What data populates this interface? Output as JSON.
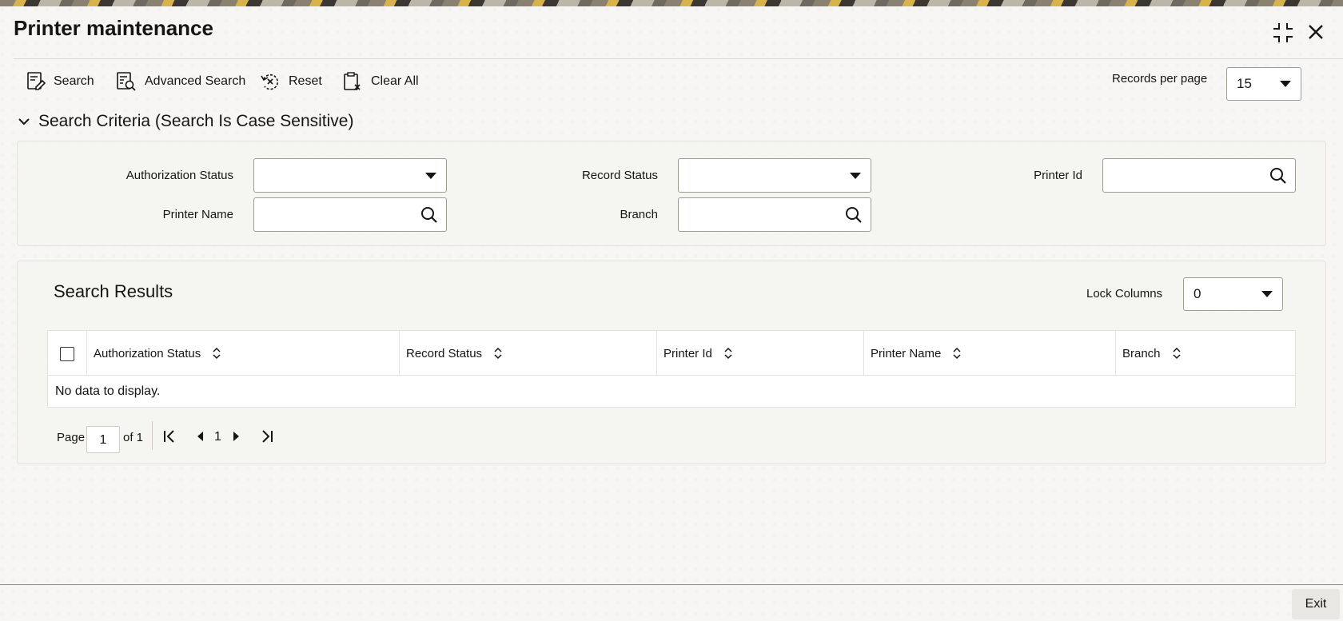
{
  "window": {
    "title": "Printer maintenance",
    "minimize_icon": "collapse-icon",
    "close_icon": "close-icon"
  },
  "toolbar": {
    "search_label": "Search",
    "advanced_search_label": "Advanced Search",
    "reset_label": "Reset",
    "clear_all_label": "Clear All",
    "records_per_page_label": "Records per page",
    "records_per_page_value": "15"
  },
  "criteria": {
    "section_title": "Search Criteria (Search Is Case Sensitive)",
    "fields": {
      "authorization_status_label": "Authorization Status",
      "authorization_status_value": "",
      "record_status_label": "Record Status",
      "record_status_value": "",
      "printer_id_label": "Printer Id",
      "printer_id_value": "",
      "printer_name_label": "Printer Name",
      "printer_name_value": "",
      "branch_label": "Branch",
      "branch_value": ""
    }
  },
  "results": {
    "title": "Search Results",
    "lock_columns_label": "Lock Columns",
    "lock_columns_value": "0",
    "columns": [
      "Authorization Status",
      "Record Status",
      "Printer Id",
      "Printer Name",
      "Branch"
    ],
    "empty_message": "No data to display."
  },
  "pager": {
    "page_label": "Page",
    "current_page": "1",
    "of_label": "of 1",
    "page_number": "1"
  },
  "footer": {
    "exit_label": "Exit"
  },
  "colors": {
    "text": "#161513",
    "panel_bg": "#f7f6f4",
    "border": "#9f9b93"
  }
}
